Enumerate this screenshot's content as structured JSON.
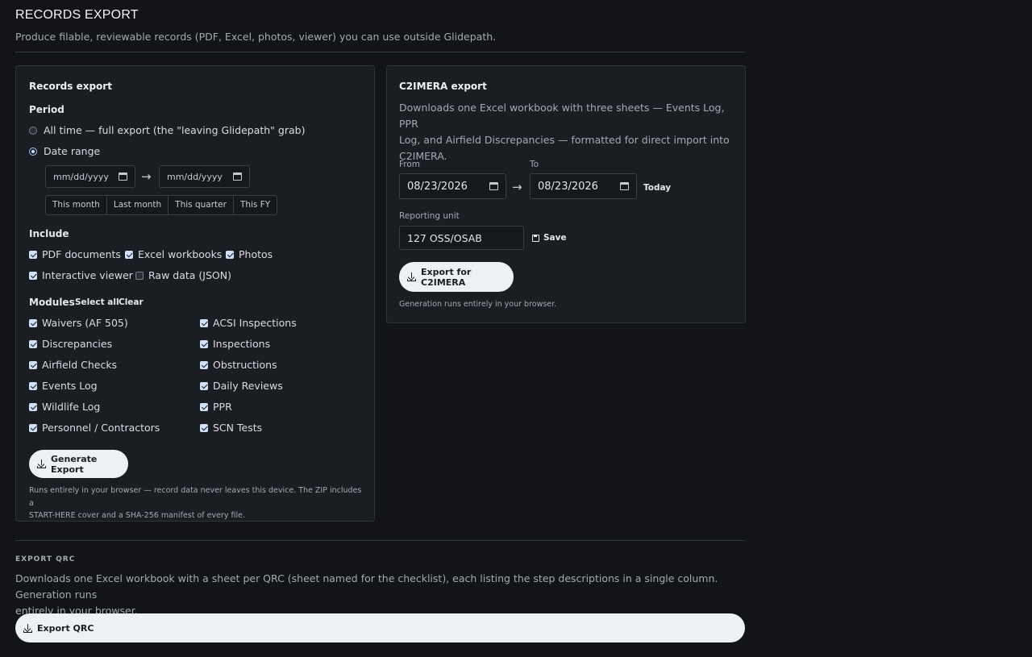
{
  "header": {
    "title": "RECORDS EXPORT",
    "subtitle": "Produce filable, reviewable records (PDF, Excel, photos, viewer) you can use outside Glidepath."
  },
  "records": {
    "title": "Records export",
    "period_label": "Period",
    "period_options": [
      {
        "label": "All time — full export (the \"leaving Glidepath\" grab)",
        "selected": false
      },
      {
        "label": "Date range",
        "selected": true
      }
    ],
    "from_placeholder": "mm/dd/yyyy",
    "to_placeholder": "mm/dd/yyyy",
    "arrow": "→",
    "quick_ranges": [
      "This month",
      "Last month",
      "This quarter",
      "This FY"
    ],
    "include_label": "Include",
    "include": [
      {
        "label": "PDF documents",
        "checked": true
      },
      {
        "label": "Excel workbooks",
        "checked": true
      },
      {
        "label": "Photos",
        "checked": true
      },
      {
        "label": "Interactive viewer",
        "checked": true
      },
      {
        "label": "Raw data (JSON)",
        "checked": false
      }
    ],
    "modules_label": "Modules",
    "select_all": "Select all",
    "clear": "Clear",
    "modules_left": [
      "Waivers (AF 505)",
      "Discrepancies",
      "Airfield Checks",
      "Events Log",
      "Wildlife Log",
      "Personnel / Contractors"
    ],
    "modules_right": [
      "ACSI Inspections",
      "Inspections",
      "Obstructions",
      "Daily Reviews",
      "PPR",
      "SCN Tests"
    ],
    "generate_label": "Generate Export",
    "note_line1": "Runs entirely in your browser — record data never leaves this device. The ZIP includes a",
    "note_line2": "START-HERE cover and a SHA-256 manifest of every file."
  },
  "c2imera": {
    "title": "C2IMERA export",
    "desc_line1": "Downloads one Excel workbook with three sheets — Events Log, PPR",
    "desc_line2": "Log, and Airfield Discrepancies — formatted for direct import into",
    "desc_line3": "C2IMERA.",
    "from_label": "From",
    "to_label": "To",
    "from_value": "08/23/2026",
    "to_value": "08/23/2026",
    "arrow": "→",
    "today_label": "Today",
    "unit_label": "Reporting unit",
    "unit_value": "127 OSS/OSAB",
    "save_label": "Save",
    "export_label": "Export for C2IMERA",
    "note": "Generation runs entirely in your browser."
  },
  "qrc": {
    "kicker": "EXPORT QRC",
    "desc_line1": "Downloads one Excel workbook with a sheet per QRC (sheet named for the checklist), each listing the step descriptions in a single column. Generation runs",
    "desc_line2": "entirely in your browser.",
    "button_label": "Export QRC"
  }
}
